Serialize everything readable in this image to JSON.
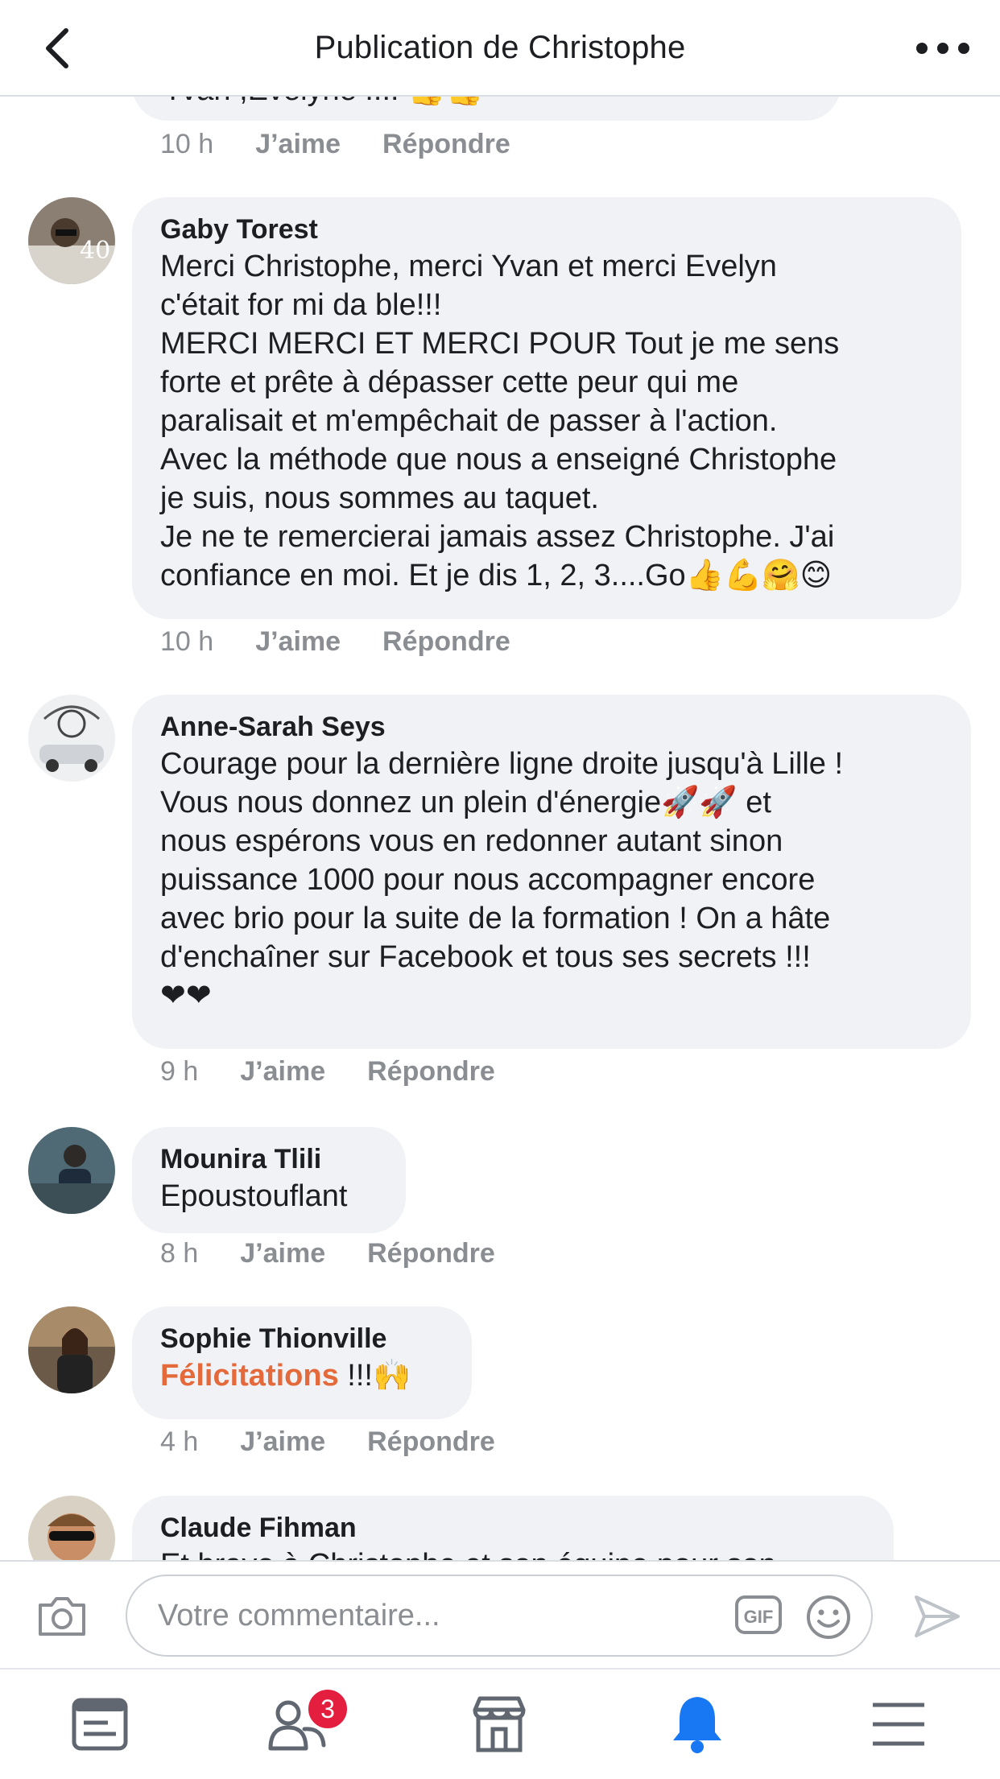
{
  "header": {
    "title": "Publication de Christophe"
  },
  "previous_comment": {
    "text_partial": "Yvan ,Evelyne !!!! 👍👍",
    "time": "10 h",
    "like": "J’aime",
    "reply": "Répondre"
  },
  "comments": [
    {
      "author": "Gaby Torest",
      "text": "Merci Christophe, merci Yvan et merci Evelyn\nc'était for mi da ble!!!\nMERCI MERCI ET MERCI POUR Tout je me sens\nforte et prête à dépasser cette peur qui me\nparalisait et m'empêchait de passer à l'action.\nAvec la méthode que nous a enseigné Christophe\nje suis, nous sommes au taquet.\nJe ne te remercierai jamais assez Christophe. J'ai\nconfiance en moi. Et je dis 1, 2, 3....Go👍💪🤗😊",
      "time": "10 h",
      "like": "J’aime",
      "reply": "Répondre"
    },
    {
      "author": "Anne-Sarah Seys",
      "text": "Courage pour la dernière ligne droite jusqu'à Lille !\nVous nous donnez un plein d'énergie🚀🚀 et\nnous espérons vous en redonner autant sinon\npuissance 1000 pour nous accompagner encore\navec brio pour la suite de la formation ! On a hâte\nd'enchaîner sur Facebook et tous ses secrets !!!\n❤❤",
      "time": "9 h",
      "like": "J’aime",
      "reply": "Répondre"
    },
    {
      "author": "Mounira Tlili",
      "text": "Epoustouflant",
      "time": "8 h",
      "like": "J’aime",
      "reply": "Répondre"
    },
    {
      "author": "Sophie Thionville",
      "text_highlight": "Félicitations",
      "text_rest": " !!!🙌",
      "time": "4 h",
      "like": "J’aime",
      "reply": "Répondre"
    },
    {
      "author": "Claude Fihman",
      "text_partial": "Et bravo à Christophe et son équipe pour son"
    }
  ],
  "composer": {
    "placeholder": "Votre commentaire...",
    "gif_label": "GIF"
  },
  "tabbar": {
    "friends_badge": "3",
    "items": [
      "news-feed-icon",
      "friends-icon",
      "marketplace-icon",
      "notifications-icon",
      "menu-icon"
    ]
  },
  "colors": {
    "bubble": "#f0f2f5",
    "secondary_text": "#8a8d91",
    "active_tab": "#1877f2",
    "badge": "#e41e3f",
    "highlight_text": "#e46a3c"
  }
}
